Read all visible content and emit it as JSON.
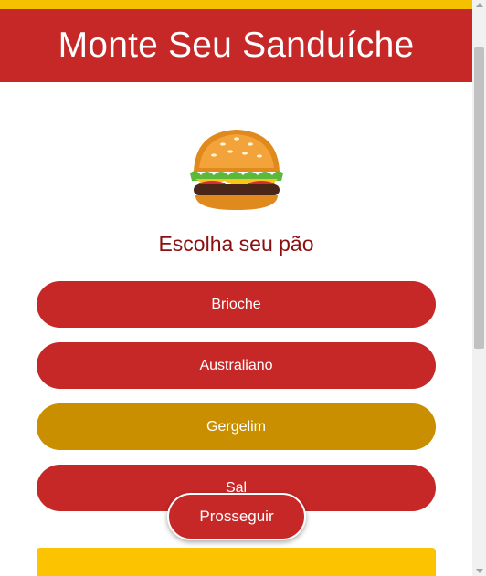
{
  "header": {
    "title": "Monte Seu Sanduíche"
  },
  "hero": {
    "icon": "hamburger-icon"
  },
  "step": {
    "title": "Escolha seu pão"
  },
  "options": [
    {
      "label": "Brioche",
      "selected": false
    },
    {
      "label": "Australiano",
      "selected": false
    },
    {
      "label": "Gergelim",
      "selected": true
    },
    {
      "label": "Sal",
      "selected": false
    }
  ],
  "actions": {
    "proceed_label": "Prosseguir"
  },
  "colors": {
    "brand_red": "#c62828",
    "selected_gold": "#c98f00",
    "accent_yellow": "#fbc300",
    "subtitle_red": "#8b0f0f"
  }
}
